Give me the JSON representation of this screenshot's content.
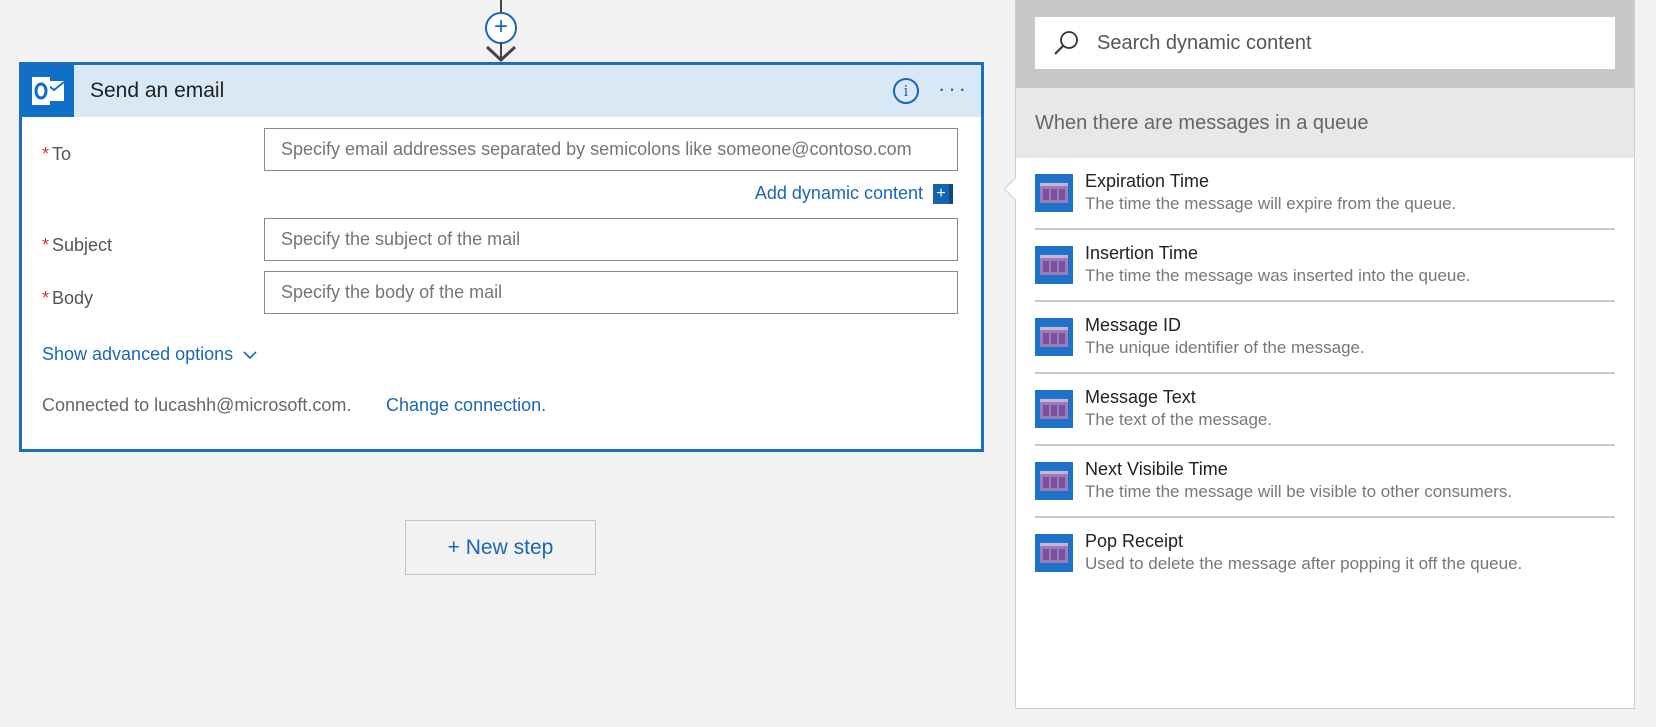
{
  "card": {
    "title": "Send an email",
    "fields": {
      "to": {
        "label": "To",
        "placeholder": "Specify email addresses separated by semicolons like someone@contoso.com"
      },
      "subject": {
        "label": "Subject",
        "placeholder": "Specify the subject of the mail"
      },
      "body": {
        "label": "Body",
        "placeholder": "Specify the body of the mail"
      }
    },
    "required_mark": "*",
    "add_dynamic_label": "Add dynamic content",
    "add_dynamic_plus": "+",
    "advanced_label": "Show advanced options",
    "connected_text": "Connected to lucashh@microsoft.com.",
    "change_connection": "Change connection."
  },
  "connector": {
    "plus": "+"
  },
  "new_step": {
    "label": "+ New step"
  },
  "panel": {
    "search_placeholder": "Search dynamic content",
    "section_title": "When there are messages in a queue",
    "items": [
      {
        "title": "Expiration Time",
        "description": "The time the message will expire from the queue."
      },
      {
        "title": "Insertion Time",
        "description": "The time the message was inserted into the queue."
      },
      {
        "title": "Message ID",
        "description": "The unique identifier of the message."
      },
      {
        "title": "Message Text",
        "description": "The text of the message."
      },
      {
        "title": "Next Visibile Time",
        "description": "The time the message will be visible to other consumers."
      },
      {
        "title": "Pop Receipt",
        "description": "Used to delete the message after popping it off the queue."
      }
    ]
  },
  "colors": {
    "accent": "#1b67b4",
    "card_border": "#1a6fc0",
    "header_bg": "#d8e8f5",
    "required": "#d13438"
  },
  "icons": {
    "outlook": "outlook-icon",
    "info": "info-icon",
    "more": "more-icon",
    "search": "search-icon",
    "queue_item": "queue-storage-icon"
  }
}
